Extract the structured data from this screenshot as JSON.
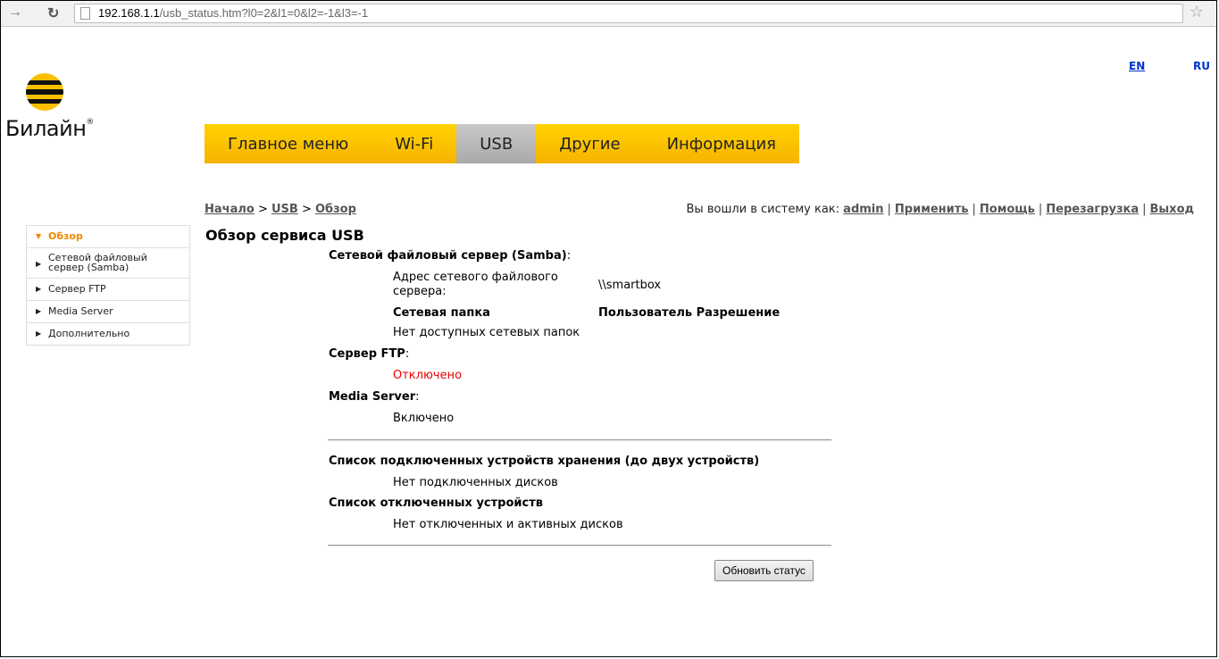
{
  "browser": {
    "url_host": "192.168.1.1",
    "url_path": "/usb_status.htm?l0=2&l1=0&l2=-1&l3=-1",
    "back_icon": "arrow-right-icon",
    "reload_icon": "reload-icon",
    "bookmark_icon": "star-icon"
  },
  "lang": {
    "en": "EN",
    "ru": "RU"
  },
  "logo": {
    "text": "Билайн",
    "mark": "®"
  },
  "main_menu": [
    {
      "label": "Главное меню",
      "active": false
    },
    {
      "label": "Wi-Fi",
      "active": false
    },
    {
      "label": "USB",
      "active": true
    },
    {
      "label": "Другие",
      "active": false
    },
    {
      "label": "Информация",
      "active": false
    }
  ],
  "breadcrumb": {
    "home": "Начало",
    "sep": " > ",
    "section": "USB",
    "page": "Обзор"
  },
  "userline": {
    "prefix": "Вы вошли в систему как:",
    "user": "admin",
    "apply": "Применить",
    "help": "Помощь",
    "reboot": "Перезагрузка",
    "logout": "Выход",
    "sep": "|"
  },
  "sidebar": [
    {
      "label": "Обзор",
      "active": true
    },
    {
      "label": "Сетевой файловый сервер (Samba)",
      "active": false
    },
    {
      "label": "Сервер FTP",
      "active": false
    },
    {
      "label": "Media Server",
      "active": false
    },
    {
      "label": "Дополнительно",
      "active": false
    }
  ],
  "content": {
    "title": "Обзор сервиса USB",
    "samba_header": "Сетевой файловый сервер (Samba)",
    "colon": ":",
    "samba_addr_label_1": "Адрес сетевого файлового",
    "samba_addr_label_2": "сервера:",
    "samba_addr_value": "\\\\smartbox",
    "col_share": "Сетевая папка",
    "col_user_perm": "Пользователь Разрешение",
    "no_shares": "Нет доступных сетевых папок",
    "ftp_header": "Сервер FTP",
    "ftp_status": "Отключено",
    "media_header": "Media Server",
    "media_status": "Включено",
    "storage_header": "Список подключенных устройств хранения (до двух устройств)",
    "no_disks": "Нет подключенных дисков",
    "disconnected_header": "Список отключенных устройств",
    "no_disconnected": "Нет отключенных и активных дисков",
    "refresh_button": "Обновить статус"
  }
}
